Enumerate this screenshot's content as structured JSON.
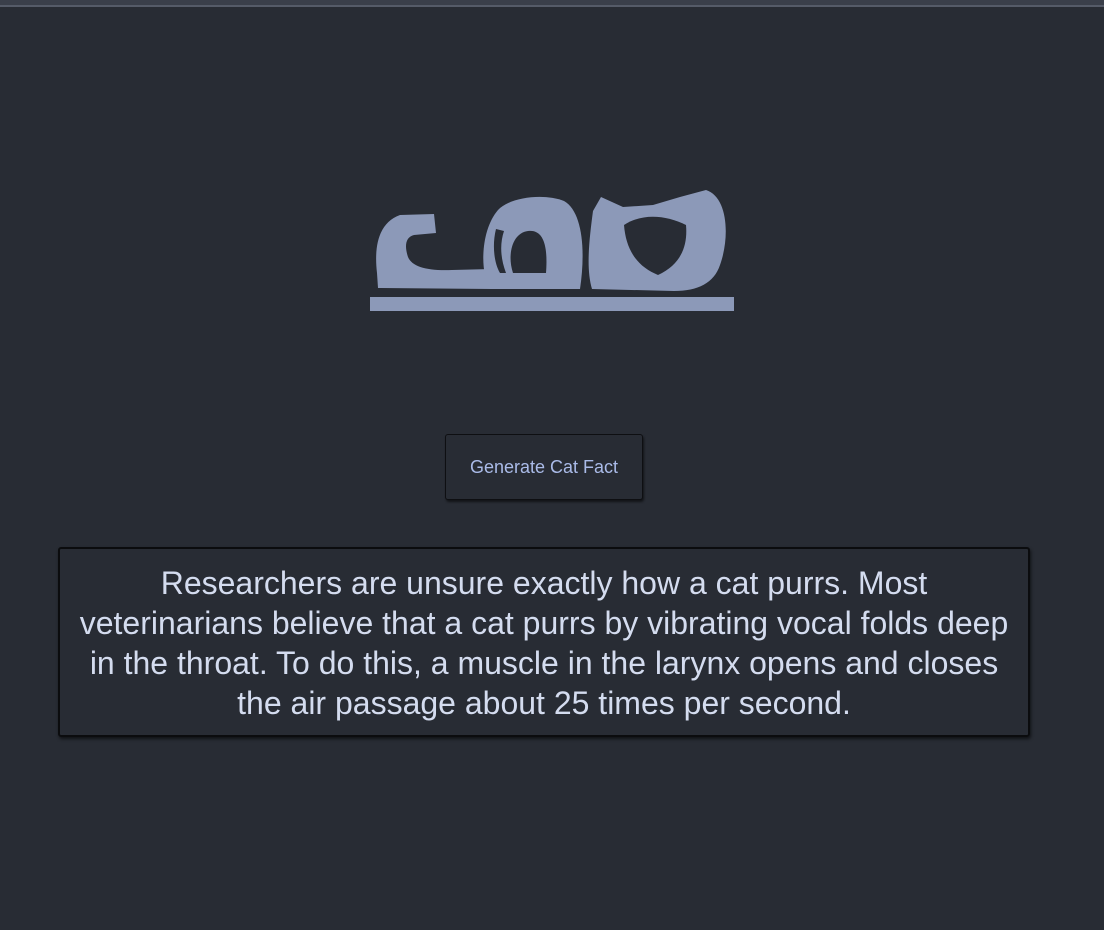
{
  "logo": {
    "icon": "cat-logo-icon",
    "color": "#8c99b8"
  },
  "generate_button": {
    "label": "Generate Cat Fact"
  },
  "fact": {
    "text": "Researchers are unsure exactly how a cat purrs. Most veterinarians believe that a cat purrs by vibrating vocal folds deep in the throat. To do this, a muscle in the larynx opens and closes the air passage about 25 times per second."
  },
  "colors": {
    "background": "#282c34",
    "button_text": "#aabbe8",
    "fact_text": "#d4dcef"
  }
}
